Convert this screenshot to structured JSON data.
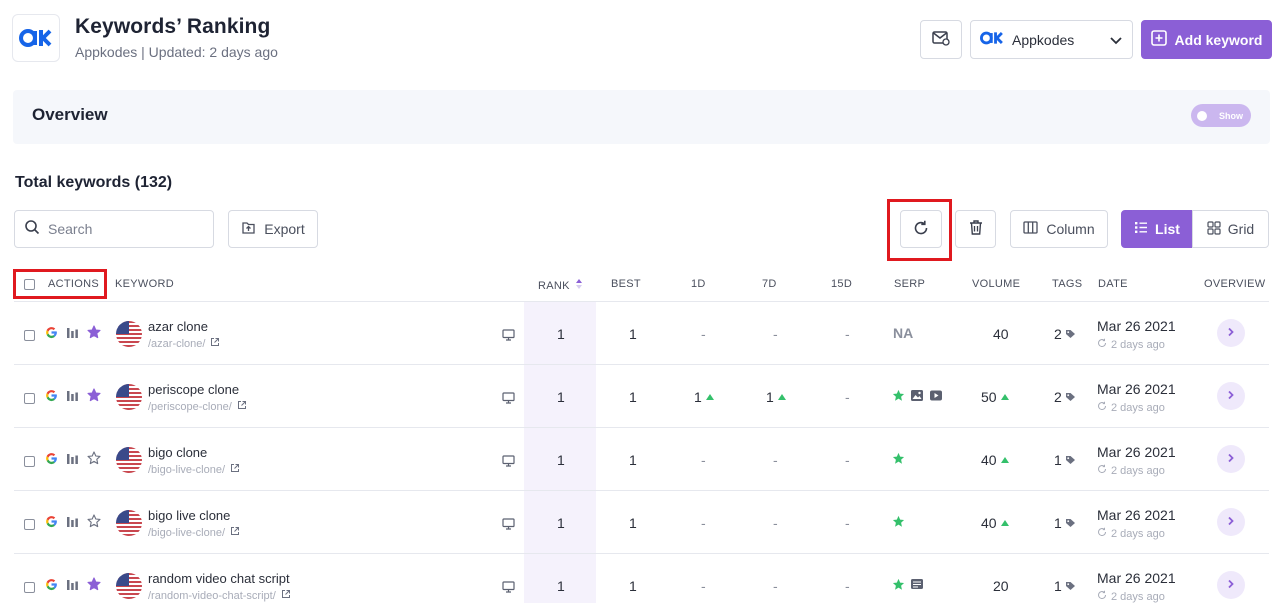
{
  "header": {
    "title": "Keywords’ Ranking",
    "subtitle": "Appkodes | Updated: 2 days ago",
    "project_name": "Appkodes",
    "add_keyword_label": "Add keyword"
  },
  "overview": {
    "title": "Overview",
    "toggle_label": "Show"
  },
  "total_label": "Total keywords (132)",
  "toolbar": {
    "search_placeholder": "Search",
    "export_label": "Export",
    "column_label": "Column",
    "list_label": "List",
    "grid_label": "Grid"
  },
  "table": {
    "headers": {
      "actions": "ACTIONS",
      "keyword": "KEYWORD",
      "rank": "RANK",
      "best": "BEST",
      "d1": "1D",
      "d7": "7D",
      "d15": "15D",
      "serp": "SERP",
      "volume": "VOLUME",
      "tags": "TAGS",
      "date": "DATE",
      "overview": "OVERVIEW"
    },
    "rows": [
      {
        "keyword": "azar clone",
        "url": "/azar-clone/",
        "starred": true,
        "rank": "1",
        "best": "1",
        "d1": "-",
        "d1_up": false,
        "d7": "-",
        "d7_up": false,
        "d15": "-",
        "serp": "NA",
        "serp_icons": [],
        "volume": "40",
        "volume_up": false,
        "tags": "2",
        "date": "Mar 26 2021",
        "ago": "2 days ago"
      },
      {
        "keyword": "periscope clone",
        "url": "/periscope-clone/",
        "starred": true,
        "rank": "1",
        "best": "1",
        "d1": "1",
        "d1_up": true,
        "d7": "1",
        "d7_up": true,
        "d15": "-",
        "serp": "",
        "serp_icons": [
          "featured-star",
          "image",
          "video"
        ],
        "volume": "50",
        "volume_up": true,
        "tags": "2",
        "date": "Mar 26 2021",
        "ago": "2 days ago"
      },
      {
        "keyword": "bigo clone",
        "url": "/bigo-live-clone/",
        "starred": false,
        "rank": "1",
        "best": "1",
        "d1": "-",
        "d1_up": false,
        "d7": "-",
        "d7_up": false,
        "d15": "-",
        "serp": "",
        "serp_icons": [
          "featured-star"
        ],
        "volume": "40",
        "volume_up": true,
        "tags": "1",
        "date": "Mar 26 2021",
        "ago": "2 days ago"
      },
      {
        "keyword": "bigo live clone",
        "url": "/bigo-live-clone/",
        "starred": false,
        "rank": "1",
        "best": "1",
        "d1": "-",
        "d1_up": false,
        "d7": "-",
        "d7_up": false,
        "d15": "-",
        "serp": "",
        "serp_icons": [
          "featured-star"
        ],
        "volume": "40",
        "volume_up": true,
        "tags": "1",
        "date": "Mar 26 2021",
        "ago": "2 days ago"
      },
      {
        "keyword": "random video chat script",
        "url": "/random-video-chat-script/",
        "starred": true,
        "rank": "1",
        "best": "1",
        "d1": "-",
        "d1_up": false,
        "d7": "-",
        "d7_up": false,
        "d15": "-",
        "serp": "",
        "serp_icons": [
          "featured-star",
          "ad"
        ],
        "volume": "20",
        "volume_up": false,
        "tags": "1",
        "date": "Mar 26 2021",
        "ago": "2 days ago"
      }
    ]
  },
  "colors": {
    "accent": "#8b5fd6",
    "highlight": "#e0191f",
    "up": "#34c06b"
  }
}
